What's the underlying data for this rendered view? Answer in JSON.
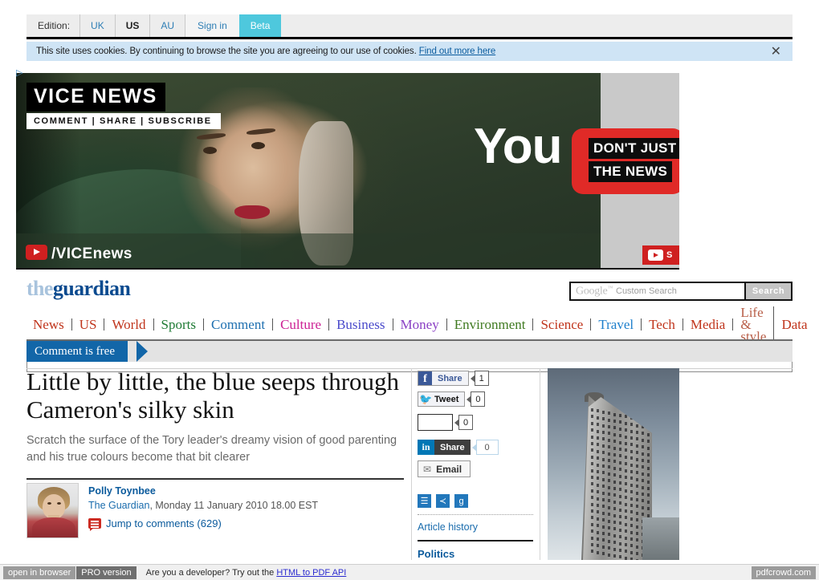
{
  "edition_bar": {
    "label": "Edition:",
    "items": [
      {
        "label": "UK",
        "active": false
      },
      {
        "label": "US",
        "active": true
      },
      {
        "label": "AU",
        "active": false
      }
    ],
    "sign_in": "Sign in",
    "beta": "Beta",
    "beta_color": "#4ec8dd"
  },
  "cookie_bar": {
    "text": "This site uses cookies. By continuing to browse the site you are agreeing to our use of cookies.",
    "link": "Find out more here",
    "close": "✕",
    "background": "#cfe4f5"
  },
  "ad": {
    "brand": "VICE NEWS",
    "subtitle": "COMMENT | SHARE | SUBSCRIBE",
    "handle": "/VICEnews",
    "youtube_word": "You",
    "tagline_line1": "DON'T JUST WA",
    "tagline_line2": "THE NEWS",
    "subscribe_label": "S",
    "adchoices_icon": "adchoices-icon"
  },
  "masthead": {
    "logo_the": "the",
    "logo_guardian": "guardian",
    "search_brand": "Google",
    "search_tm": "™",
    "search_placeholder": "Custom Search",
    "search_button": "Search"
  },
  "nav": [
    {
      "label": "News",
      "color": "#c0341b"
    },
    {
      "label": "US",
      "color": "#c0341b"
    },
    {
      "label": "World",
      "color": "#c0341b"
    },
    {
      "label": "Sports",
      "color": "#1d7a33"
    },
    {
      "label": "Comment",
      "color": "#1d6fb0"
    },
    {
      "label": "Culture",
      "color": "#cc2094"
    },
    {
      "label": "Business",
      "color": "#4a4acb"
    },
    {
      "label": "Money",
      "color": "#8a3fc4"
    },
    {
      "label": "Environment",
      "color": "#3f7a20"
    },
    {
      "label": "Science",
      "color": "#c0341b"
    },
    {
      "label": "Travel",
      "color": "#1d7fcc"
    },
    {
      "label": "Tech",
      "color": "#c0341b"
    },
    {
      "label": "Media",
      "color": "#c0341b"
    },
    {
      "label": "Life & style",
      "color": "#b9604a"
    },
    {
      "label": "Data",
      "color": "#c0341b"
    }
  ],
  "section_tab": {
    "label": "Comment is free",
    "color": "#1266a8"
  },
  "article": {
    "headline": "Little by little, the blue seeps through Cameron's silky skin",
    "standfirst": "Scratch the surface of the Tory leader's dreamy vision of good parenting and his true colours become that bit clearer",
    "author": "Polly Toynbee",
    "publication": "The Guardian",
    "publication_meta": ", Monday 11 January 2010 18.00 EST",
    "jump_to_comments": "Jump to comments (629)",
    "avatar_name": "avatar"
  },
  "share": {
    "facebook_label": "Share",
    "facebook_count": "1",
    "twitter_label": "Tweet",
    "twitter_count": "0",
    "gplus_count": "0",
    "linkedin_label": "Share",
    "linkedin_count": "0",
    "email_label": "Email",
    "icons": [
      {
        "name": "print-icon",
        "glyph": "☰"
      },
      {
        "name": "share-icon",
        "glyph": "≺"
      },
      {
        "name": "guardian-g-icon",
        "glyph": "g"
      }
    ],
    "article_history": "Article history"
  },
  "related": {
    "section_label": "Politics"
  },
  "pdf_footer": {
    "open_in_browser": "open in browser",
    "pro_version": "PRO version",
    "developer_text": "Are you a developer? Try out the",
    "api_link": "HTML to PDF API",
    "brand": "pdfcrowd.com"
  }
}
